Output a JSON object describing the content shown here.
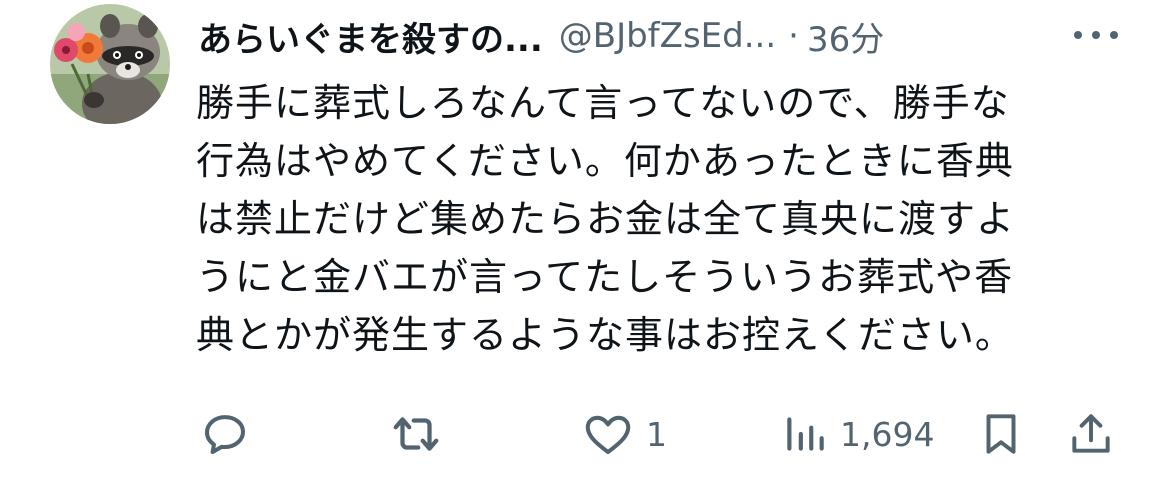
{
  "tweet": {
    "display_name": "あらいぐまを殺すの...",
    "handle": "@BJbfZsEd...",
    "separator": "·",
    "time": "36分",
    "text": "勝手に葬式しろなんて言ってないので、勝手な\n行為はやめてください。何かあったときに香典\nは禁止だけど集めたらお金は全て真央に渡すよ\nうにと金バエが言ってたしそういうお葬式や香\n典とかが発生するような事はお控えください。",
    "likes": "1",
    "views": "1,694"
  },
  "icons": {
    "avatar": "raccoon-with-flowers-avatar",
    "more": "more-dots-icon",
    "reply": "reply-icon",
    "repost": "repost-icon",
    "like": "heart-icon",
    "views": "views-bar-icon",
    "bookmark": "bookmark-icon",
    "share": "share-icon"
  },
  "colors": {
    "text_primary": "#0f1419",
    "text_secondary": "#536471",
    "background": "#ffffff"
  }
}
